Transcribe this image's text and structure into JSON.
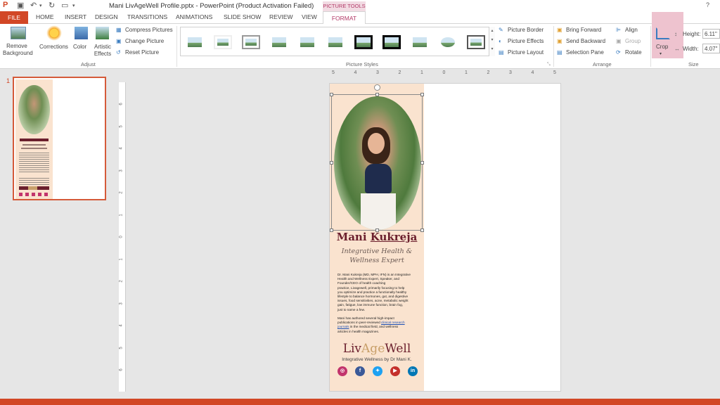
{
  "window": {
    "title": "Mani LivAgeWell Profile.pptx - PowerPoint (Product Activation Failed)",
    "context_tab_group": "PICTURE TOOLS",
    "help": "?"
  },
  "tabs": [
    {
      "label": "FILE"
    },
    {
      "label": "HOME"
    },
    {
      "label": "INSERT"
    },
    {
      "label": "DESIGN"
    },
    {
      "label": "TRANSITIONS"
    },
    {
      "label": "ANIMATIONS"
    },
    {
      "label": "SLIDE SHOW"
    },
    {
      "label": "REVIEW"
    },
    {
      "label": "VIEW"
    },
    {
      "label": "FORMAT"
    }
  ],
  "ribbon": {
    "adjust": {
      "group_label": "Adjust",
      "remove_background": "Remove Background",
      "corrections": "Corrections",
      "color": "Color",
      "artistic_effects": "Artistic Effects",
      "compress_pictures": "Compress Pictures",
      "change_picture": "Change Picture",
      "reset_picture": "Reset Picture"
    },
    "picture_styles": {
      "group_label": "Picture Styles",
      "picture_border": "Picture Border",
      "picture_effects": "Picture Effects",
      "picture_layout": "Picture Layout"
    },
    "arrange": {
      "group_label": "Arrange",
      "bring_forward": "Bring Forward",
      "send_backward": "Send Backward",
      "selection_pane": "Selection Pane",
      "align": "Align",
      "group": "Group",
      "rotate": "Rotate"
    },
    "size": {
      "group_label": "Size",
      "crop": "Crop",
      "height_label": "Height:",
      "height_value": "6.11\"",
      "width_label": "Width:",
      "width_value": "4.07\""
    }
  },
  "thumbnail": {
    "slide_number": "1"
  },
  "slide": {
    "name_first": "Mani ",
    "name_last": "Kukreja",
    "subtitle_line1": "Integrative Health &",
    "subtitle_line2": "Wellness Expert",
    "bio_lines": [
      "Dr. Mani Kukreja (MD, MPH, IFN) is an Integrative",
      "Health and Wellness Expert, Speaker, and",
      "Founder/CEO of health coaching",
      "practice, Livagewell, primarily focusing to help",
      "you optimize and practice a functionally healthy",
      "lifestyle to balance hormones, gut, and digestive",
      "issues, food sensitivities, acne, metabolic weight",
      "gain, fatigue, low immune function, brain fog,",
      "just to name a few."
    ],
    "pub_line1_pre": "Mani has authored several high-impact",
    "pub_line2_pre": "publications in peer-reviewed ",
    "pub_link1": "clinical research",
    "pub_link2": "journals",
    "pub_line3_post": " in the medical field, and wellness",
    "pub_line4": "articles in health magazines.",
    "brand_a": "Liv",
    "brand_b": "Age",
    "brand_c": "Well",
    "tagline": "Integrative Wellness by Dr Mani K.",
    "social": [
      "instagram-icon",
      "facebook-icon",
      "twitter-icon",
      "youtube-icon",
      "linkedin-icon"
    ],
    "colors": {
      "panel_bg": "#fae3cf",
      "name": "#6b1f2d",
      "brand_liv": "#6b1f2d",
      "brand_age": "#c9a06a",
      "accent": "#d24726"
    }
  },
  "ruler_h": [
    "5",
    "4",
    "3",
    "2",
    "1",
    "0",
    "1",
    "2",
    "3",
    "4",
    "5"
  ],
  "ruler_v": [
    "6",
    "5",
    "4",
    "3",
    "2",
    "1",
    "0",
    "1",
    "2",
    "3",
    "4",
    "5",
    "6"
  ]
}
